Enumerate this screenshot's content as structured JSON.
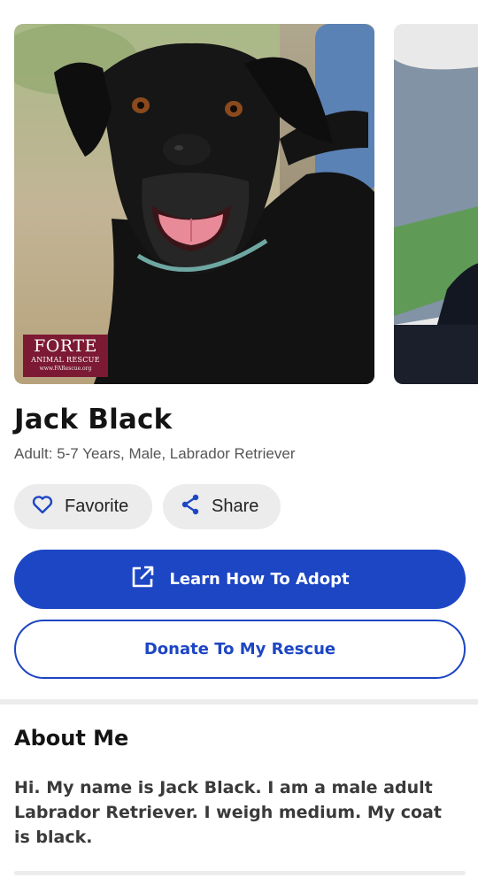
{
  "gallery": {
    "main_photo_alt": "Jack Black",
    "logo": {
      "line1": "FORTE",
      "line2": "ANIMAL RESCUE",
      "line3": "www.FARescue.org"
    }
  },
  "pet": {
    "name": "Jack Black",
    "info": "Adult: 5-7 Years, Male, Labrador Retriever"
  },
  "actions": {
    "favorite_label": "Favorite",
    "share_label": "Share",
    "adopt_label": "Learn How To Adopt",
    "donate_label": "Donate To My Rescue"
  },
  "about": {
    "title": "About Me",
    "text": "Hi. My name is Jack Black. I am a male adult Labrador Retriever. I weigh medium. My coat is black."
  },
  "colors": {
    "accent": "#1d46c4",
    "chip_bg": "#ececec",
    "logo_bg": "#7d1a33"
  },
  "icons": {
    "favorite": "heart-icon",
    "share": "share-icon",
    "adopt": "external-link-icon"
  }
}
